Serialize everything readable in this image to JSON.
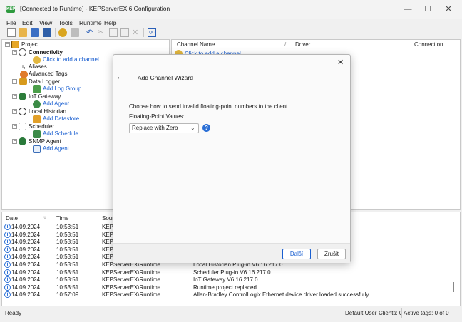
{
  "window": {
    "title": "[Connected to Runtime] - KEPServerEX 6 Configuration",
    "app_icon_text": "KEP"
  },
  "menu": [
    "File",
    "Edit",
    "View",
    "Tools",
    "Runtime",
    "Help"
  ],
  "tree": {
    "project": "Project",
    "connectivity": "Connectivity",
    "add_channel": "Click to add a channel.",
    "aliases": "Aliases",
    "advanced_tags": "Advanced Tags",
    "data_logger": "Data Logger",
    "add_log_group": "Add Log Group...",
    "iot_gateway": "IoT Gateway",
    "add_agent": "Add Agent...",
    "local_historian": "Local Historian",
    "add_datastore": "Add Datastore...",
    "scheduler": "Scheduler",
    "add_schedule": "Add Schedule...",
    "snmp_agent": "SNMP Agent",
    "add_snmp_agent": "Add Agent..."
  },
  "channel_table": {
    "col_name": "Channel Name",
    "col_driver": "Driver",
    "col_connection": "Connection",
    "row_text": "Click to add a channel."
  },
  "log": {
    "headers": [
      "Date",
      "Time",
      "Sourc"
    ],
    "rows": [
      {
        "date": "14.09.2024",
        "time": "10:53:51",
        "source": "KEPS",
        "event": ""
      },
      {
        "date": "14.09.2024",
        "time": "10:53:51",
        "source": "KEPS",
        "event": ""
      },
      {
        "date": "14.09.2024",
        "time": "10:53:51",
        "source": "KEPS",
        "event": ""
      },
      {
        "date": "14.09.2024",
        "time": "10:53:51",
        "source": "KEPS",
        "event": ""
      },
      {
        "date": "14.09.2024",
        "time": "10:53:51",
        "source": "KEPS",
        "event": ""
      },
      {
        "date": "14.09.2024",
        "time": "10:53:51",
        "source": "KEPServerEX\\Runtime",
        "event": "Local Historian Plug-in V6.16.217.0"
      },
      {
        "date": "14.09.2024",
        "time": "10:53:51",
        "source": "KEPServerEX\\Runtime",
        "event": "Scheduler Plug-in V6.16.217.0"
      },
      {
        "date": "14.09.2024",
        "time": "10:53:51",
        "source": "KEPServerEX\\Runtime",
        "event": "IoT Gateway V6.16.217.0"
      },
      {
        "date": "14.09.2024",
        "time": "10:53:51",
        "source": "KEPServerEX\\Runtime",
        "event": "Runtime project replaced."
      },
      {
        "date": "14.09.2024",
        "time": "10:57:09",
        "source": "KEPServerEX\\Runtime",
        "event": "Allen-Bradley ControlLogix Ethernet device driver loaded successfully."
      }
    ]
  },
  "status": {
    "left": "Ready",
    "user": "Default User",
    "clients": "Clients: 0",
    "active_tags": "Active tags: 0 of 0"
  },
  "dialog": {
    "title": "Add Channel Wizard",
    "prompt": "Choose how to send invalid floating-point numbers to the client.",
    "field_label": "Floating-Point Values:",
    "selected_value": "Replace with Zero",
    "next_button": "Další",
    "cancel_button": "Zrušit"
  }
}
